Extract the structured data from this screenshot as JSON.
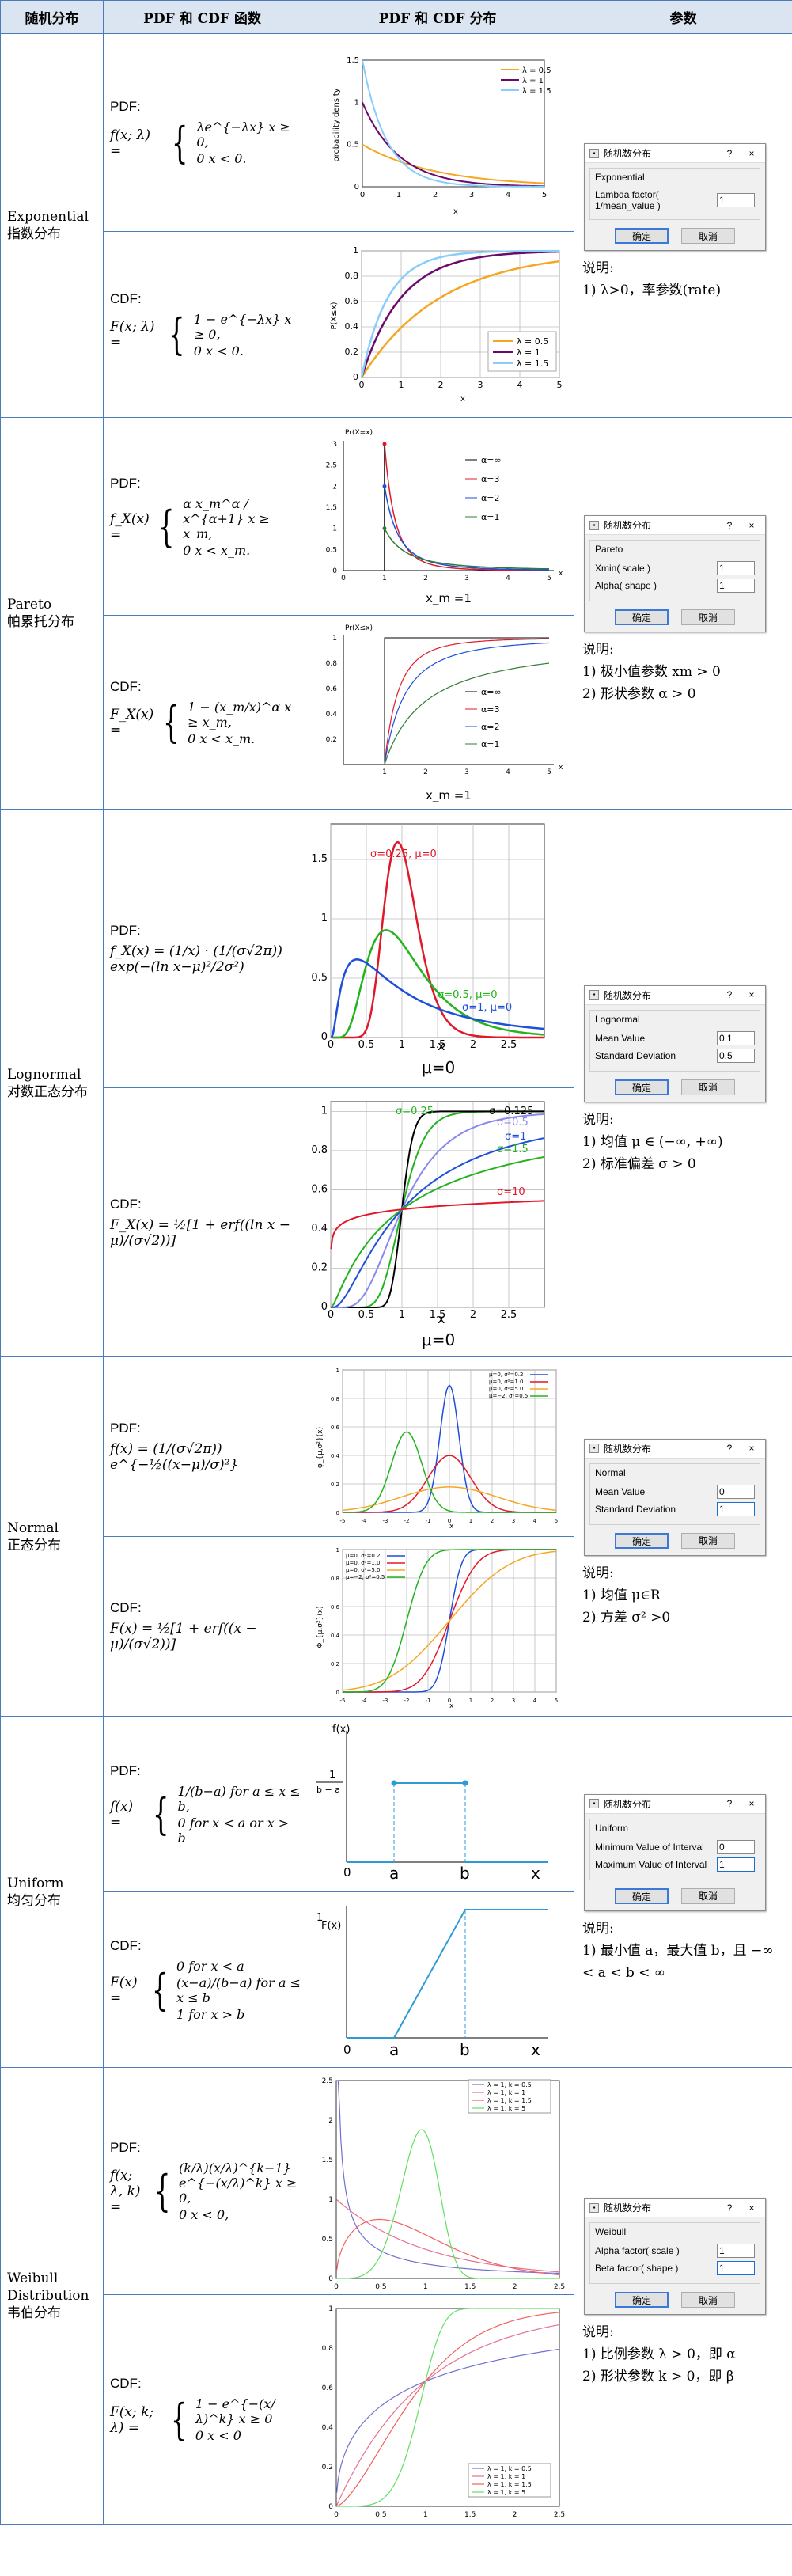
{
  "headers": {
    "col1": "随机分布",
    "col2": "PDF 和 CDF 函数",
    "col3": "PDF 和 CDF 分布",
    "col4": "参数"
  },
  "labels": {
    "pdf": "PDF:",
    "cdf": "CDF:",
    "note": "说明:",
    "ok": "确定",
    "cancel": "取消",
    "dlg_title": "随机数分布",
    "q": "?",
    "x": "×"
  },
  "rows": [
    {
      "name": "Exponential",
      "cn": "指数分布",
      "group": "Exponential",
      "fields": [
        {
          "label": "Lambda factor( 1/mean_value )",
          "value": "1"
        }
      ],
      "notes": [
        "1)  λ>0，率参数(rate)"
      ]
    },
    {
      "name": "Pareto",
      "cn": "帕累托分布",
      "group": "Pareto",
      "fields": [
        {
          "label": "Xmin( scale )",
          "value": "1"
        },
        {
          "label": "Alpha( shape )",
          "value": "1"
        }
      ],
      "notes": [
        "1)  极小值参数 xm > 0",
        "2)  形状参数 α > 0"
      ]
    },
    {
      "name": "Lognormal",
      "cn": "对数正态分布",
      "group": "Lognormal",
      "fields": [
        {
          "label": "Mean Value",
          "value": "0.1"
        },
        {
          "label": "Standard Deviation",
          "value": "0.5"
        }
      ],
      "notes": [
        "1)  均值 μ ∈ (−∞, +∞)",
        "2)  标准偏差 σ > 0"
      ]
    },
    {
      "name": "Normal",
      "cn": "正态分布",
      "group": "Normal",
      "fields": [
        {
          "label": "Mean Value",
          "value": "0"
        },
        {
          "label": "Standard Deviation",
          "value": "1"
        }
      ],
      "notes": [
        "1) 均值 μ∈R",
        "2) 方差 σ² >0"
      ]
    },
    {
      "name": "Uniform",
      "cn": "均匀分布",
      "group": "Uniform",
      "fields": [
        {
          "label": "Minimum Value of Interval",
          "value": "0"
        },
        {
          "label": "Maximum Value of Interval",
          "value": "1"
        }
      ],
      "notes": [
        "1)  最小值 a，最大值 b，且 −∞ < a < b < ∞"
      ]
    },
    {
      "name": "Weibull Distribution",
      "cn": "韦伯分布",
      "group": "Weibull",
      "fields": [
        {
          "label": "Alpha factor( scale )",
          "value": "1"
        },
        {
          "label": "Beta factor( shape )",
          "value": "1"
        }
      ],
      "notes": [
        "1)  比例参数 λ > 0，即 α",
        "2)  形状参数 k > 0，即 β"
      ]
    }
  ],
  "formulas": {
    "exp_pdf": "f(x; λ) =",
    "exp_pdf_c1": "λe^{−λx}    x ≥ 0,",
    "exp_pdf_c2": "0            x < 0.",
    "exp_cdf": "F(x; λ) =",
    "exp_cdf_c1": "1 − e^{−λx}   x ≥ 0,",
    "exp_cdf_c2": "0               x < 0.",
    "par_pdf": "f_X(x) =",
    "par_pdf_c1": "α x_m^α / x^{α+1}    x ≥ x_m,",
    "par_pdf_c2": "0                  x < x_m.",
    "par_cdf": "F_X(x) =",
    "par_cdf_c1": "1 − (x_m/x)^α    x ≥ x_m,",
    "par_cdf_c2": "0                x < x_m.",
    "log_pdf": "f_X(x) = (1/x) · (1/(σ√2π)) exp(−(ln x−μ)²/2σ²)",
    "log_cdf": "F_X(x) = ½[1 + erf((ln x − μ)/(σ√2))]",
    "nor_pdf": "f(x) = (1/(σ√2π)) e^{−½((x−μ)/σ)²}",
    "nor_cdf": "F(x) = ½[1 + erf((x − μ)/(σ√2))]",
    "uni_pdf": "f(x) =",
    "uni_pdf_c1": "1/(b−a)   for a ≤ x ≤ b,",
    "uni_pdf_c2": "0          for x < a or x > b",
    "uni_cdf": "F(x) =",
    "uni_cdf_c1": "0          for x < a",
    "uni_cdf_c2": "(x−a)/(b−a)  for a ≤ x ≤ b",
    "uni_cdf_c3": "1          for x > b",
    "wei_pdf": "f(x; λ, k) =",
    "wei_pdf_c1": "(k/λ)(x/λ)^{k−1} e^{−(x/λ)^k}   x ≥ 0,",
    "wei_pdf_c2": "0                              x < 0,",
    "wei_cdf": "F(x; k; λ) =",
    "wei_cdf_c1": "1 − e^{−(x/λ)^k}    x ≥ 0",
    "wei_cdf_c2": "0                   x < 0"
  },
  "plot_text": {
    "exp_pdf_ylabel": "probability density",
    "exp_cdf_ylabel": "P(X≤x)",
    "x": "x",
    "exp_legend": [
      "λ = 0.5",
      "λ = 1",
      "λ = 1.5"
    ],
    "par_pdf_ylabel": "Pr(X=x)",
    "par_cdf_ylabel": "Pr(X≤x)",
    "par_xm": "x_m =1",
    "par_legend": [
      "α=∞",
      "α=3",
      "α=2",
      "α=1"
    ],
    "log_mu": "μ=0",
    "log_pdf_labels": [
      "σ=0.25, μ=0",
      "σ=0.5, μ=0",
      "σ=1, μ=0"
    ],
    "log_cdf_labels": [
      "σ=0.25",
      "σ=0.125",
      "σ=0.5",
      "σ=1",
      "σ=1.5",
      "σ=10"
    ],
    "nor_ylabel_pdf": "φ_{μ,σ²}(x)",
    "nor_ylabel_cdf": "Φ_{μ,σ²}(x)",
    "nor_legend": [
      "μ=0,  σ²=0.2",
      "μ=0,  σ²=1.0",
      "μ=0,  σ²=5.0",
      "μ=−2, σ²=0.5"
    ],
    "uni_fx": "f(x)",
    "uni_Fx": "F(x)",
    "uni_inv": "1",
    "uni_inv_den": "b − a",
    "uni_a": "a",
    "uni_b": "b",
    "uni_0": "0",
    "wei_legend": [
      "λ = 1, k = 0.5",
      "λ = 1, k = 1",
      "λ = 1, k = 1.5",
      "λ = 1, k = 5"
    ]
  },
  "colors": {
    "orange": "#f5a623",
    "purple": "#6a0a6a",
    "lightblue": "#87cefa",
    "blue": "#1e4fd8",
    "red": "#e0182a",
    "green": "#22b31e",
    "black": "#000000",
    "darkgreen": "#2e7d32",
    "uniform": "#2e9bd6",
    "wpurple": "#7070d0",
    "wpink": "#e87090",
    "wred": "#f06060",
    "wgreen": "#60e060"
  }
}
